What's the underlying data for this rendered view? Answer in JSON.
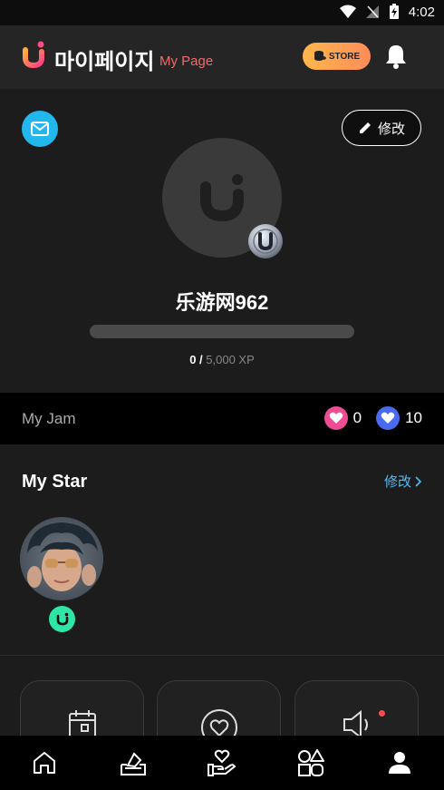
{
  "status_bar": {
    "time": "4:02"
  },
  "header": {
    "title_ko": "마이페이지",
    "title_en": "My Page",
    "store_label": "STORE"
  },
  "profile": {
    "edit_label": "修改",
    "username": "乐游网962",
    "xp_current": "0",
    "xp_separator": " / ",
    "xp_total": "5,000 XP",
    "xp_progress": 0
  },
  "jam": {
    "title": "My Jam",
    "pink_heart_count": "0",
    "blue_heart_count": "10"
  },
  "mystar": {
    "title": "My Star",
    "edit_label": "修改"
  },
  "colors": {
    "accent_pink": "#f26b6b",
    "link_blue": "#5ab8f0",
    "mail_blue": "#22b8ee",
    "star_green": "#2ee6a6"
  },
  "nav": {
    "items": [
      "home-icon",
      "vote-icon",
      "charity-icon",
      "category-icon",
      "profile-icon"
    ],
    "active": "profile-icon"
  }
}
